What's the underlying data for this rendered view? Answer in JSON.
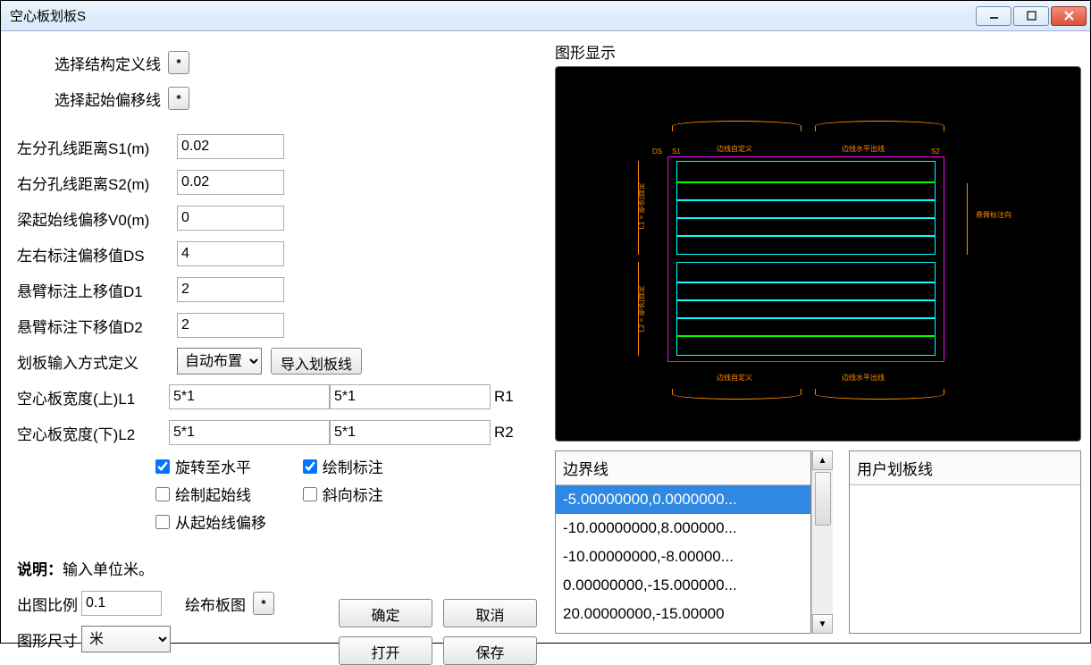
{
  "window": {
    "title": "空心板划板S"
  },
  "selectors": {
    "struct_line": "选择结构定义线",
    "offset_line": "选择起始偏移线",
    "ast": "*"
  },
  "params": {
    "s1_label": "左分孔线距离S1(m)",
    "s1_value": "0.02",
    "s2_label": "右分孔线距离S2(m)",
    "s2_value": "0.02",
    "v0_label": "梁起始线偏移V0(m)",
    "v0_value": "0",
    "ds_label": "左右标注偏移值DS",
    "ds_value": "4",
    "d1_label": "悬臂标注上移值D1",
    "d1_value": "2",
    "d2_label": "悬臂标注下移值D2",
    "d2_value": "2",
    "mode_label": "划板输入方式定义",
    "mode_value": "自动布置",
    "import_btn": "导入划板线",
    "width_top_label": "空心板宽度(上)L1",
    "width_top_L": "5*1",
    "width_top_R": "5*1",
    "width_top_suffix": "R1",
    "width_bot_label": "空心板宽度(下)L2",
    "width_bot_L": "5*1",
    "width_bot_R": "5*1",
    "width_bot_suffix": "R2"
  },
  "checks": {
    "rotate": {
      "label": "旋转至水平",
      "checked": true
    },
    "annot": {
      "label": "绘制标注",
      "checked": true
    },
    "start": {
      "label": "绘制起始线",
      "checked": false
    },
    "skew": {
      "label": "斜向标注",
      "checked": false
    },
    "offset": {
      "label": "从起始线偏移",
      "checked": false
    }
  },
  "footer": {
    "note_prefix": "说明：",
    "note_text": "输入单位米。",
    "scale_label": "出图比例",
    "scale_value": "0.1",
    "layout_label": "绘布板图",
    "layout_ast": "*",
    "size_label": "图形尺寸",
    "size_value": "米",
    "ok": "确定",
    "cancel": "取消",
    "open": "打开",
    "save": "保存"
  },
  "preview": {
    "title": "图形显示",
    "labels": {
      "ds": "DS",
      "s1": "S1",
      "s2": "S2",
      "l1": "L1 = 部长|自定",
      "l2": "L2 = 部长|自定",
      "curve_top_l": "边线自定义",
      "curve_top_r": "边线水平出线",
      "curve_bot_l": "边线自定义",
      "curve_bot_r": "边线水平出线",
      "dim_right": "悬臂标注向"
    }
  },
  "lists": {
    "boundary_header": "边界线",
    "boundary": [
      "-5.00000000,0.0000000...",
      "-10.00000000,8.000000...",
      "-10.00000000,-8.00000...",
      "0.00000000,-15.000000...",
      "20.00000000,-15.00000"
    ],
    "boundary_selected": 0,
    "user_header": "用户划板线",
    "user": []
  }
}
